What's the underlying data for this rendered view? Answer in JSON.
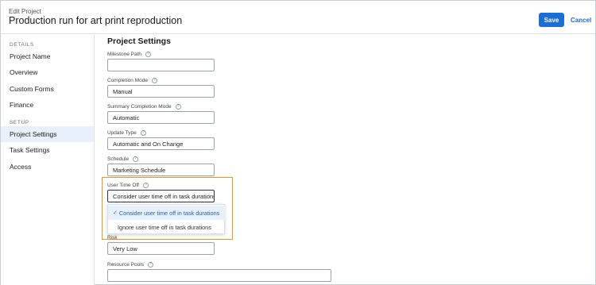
{
  "header": {
    "eyebrow": "Edit Project",
    "title": "Production run for art print reproduction",
    "save_label": "Save",
    "cancel_label": "Cancel"
  },
  "sidebar": {
    "details_heading": "DETAILS",
    "setup_heading": "SETUP",
    "items": [
      {
        "label": "Project Name"
      },
      {
        "label": "Overview"
      },
      {
        "label": "Custom Forms"
      },
      {
        "label": "Finance"
      },
      {
        "label": "Project Settings",
        "active": true
      },
      {
        "label": "Task Settings"
      },
      {
        "label": "Access"
      }
    ]
  },
  "main": {
    "section_title": "Project Settings",
    "help_glyph": "?",
    "fields": {
      "milestone_path": {
        "label": "Milestone Path",
        "value": ""
      },
      "completion_mode": {
        "label": "Completion Mode",
        "value": "Manual"
      },
      "summary_completion_mode": {
        "label": "Summary Completion Mode",
        "value": "Automatic"
      },
      "update_type": {
        "label": "Update Type",
        "value": "Automatic and On Change"
      },
      "schedule": {
        "label": "Schedule",
        "value": "Marketing Schedule"
      },
      "user_time_off": {
        "label": "User Time Off",
        "value": "Consider user time off in task durations",
        "options": [
          {
            "label": "Consider user time off in task durations",
            "selected": true
          },
          {
            "label": "Ignore user time off in task durations",
            "selected": false
          }
        ]
      },
      "risk": {
        "label": "Risk",
        "value": "Very Low"
      },
      "resource_pools": {
        "label": "Resource Pools",
        "value": ""
      }
    }
  },
  "colors": {
    "accent": "#1b6ed6",
    "highlight": "#f0941c",
    "active_bg": "#e8f1fb"
  },
  "icons": {
    "help": "question-circle-icon",
    "check": "checkmark-icon"
  }
}
